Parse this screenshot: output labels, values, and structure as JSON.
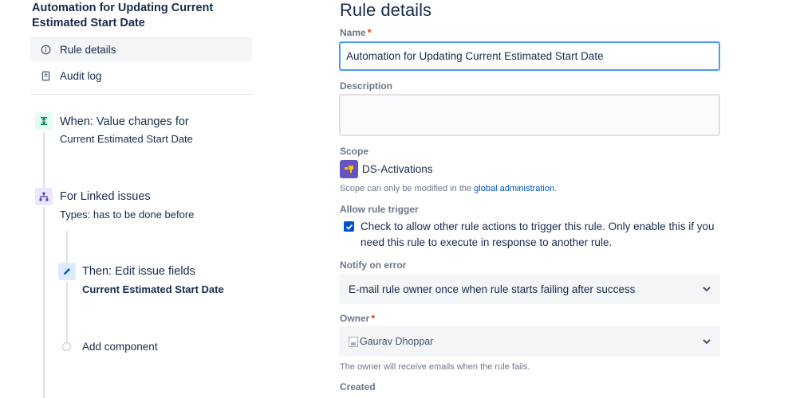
{
  "rule": {
    "title": "Automation for Updating Current Estimated Start Date"
  },
  "nav": {
    "items": [
      {
        "label": "Rule details",
        "icon": "info-icon"
      },
      {
        "label": "Audit log",
        "icon": "audit-log-icon"
      }
    ]
  },
  "flow": {
    "trigger": {
      "title": "When: Value changes for",
      "subtitle": "Current Estimated Start Date",
      "icon": "field-change-icon"
    },
    "branch": {
      "title": "For Linked issues",
      "subtitle": "Types: has to be done before",
      "icon": "branch-icon"
    },
    "action": {
      "title": "Then: Edit issue fields",
      "subtitle": "Current Estimated Start Date",
      "icon": "pencil-icon"
    },
    "add_component": "Add component"
  },
  "details": {
    "heading": "Rule details",
    "name_label": "Name",
    "name_required": "*",
    "name_value": "Automation for Updating Current Estimated Start Date",
    "description_label": "Description",
    "description_value": "",
    "scope_label": "Scope",
    "scope_value": "DS-Activations",
    "scope_helper_prefix": "Scope can only be modified in the ",
    "scope_helper_link": "global administration",
    "scope_helper_suffix": ".",
    "trigger_label": "Allow rule trigger",
    "trigger_checked": true,
    "trigger_text": "Check to allow other rule actions to trigger this rule. Only enable this if you need this rule to execute in response to another rule.",
    "notify_label": "Notify on error",
    "notify_value": "E-mail rule owner once when rule starts failing after success",
    "owner_label": "Owner",
    "owner_required": "*",
    "owner_value": "Gaurav Dhoppar",
    "owner_helper": "The owner will receive emails when the rule fails.",
    "created_label": "Created"
  },
  "colors": {
    "accent": "#0052cc",
    "focus_border": "#4c9aff",
    "required": "#de350b",
    "project_avatar": "#6554c0",
    "trigger_icon_bg": "#e3fcef",
    "branch_icon_bg": "#eae6ff",
    "action_icon_bg": "#deebff"
  }
}
